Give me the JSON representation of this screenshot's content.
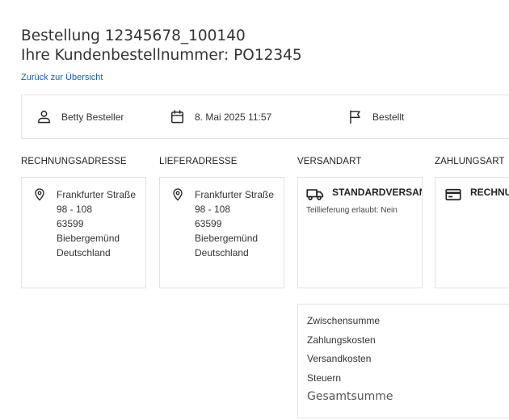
{
  "order": {
    "title": "Bestellung 12345678_100140",
    "customer_order_line": "Ihre Kundenbestellnummer: PO12345",
    "back_link": "Zurück zur Übersicht"
  },
  "summary": {
    "customer": "Betty Besteller",
    "date": "8. Mai 2025 11:57",
    "status": "Bestellt"
  },
  "sections": {
    "billing": {
      "heading": "RECHNUNGSADRESSE",
      "street": "Frankfurter Straße",
      "number": "98 - 108",
      "zip": "63599",
      "city": "Biebergemünd",
      "country": "Deutschland"
    },
    "shipping": {
      "heading": "LIEFERADRESSE",
      "street": "Frankfurter Straße",
      "number": "98 - 108",
      "zip": "63599",
      "city": "Biebergemünd",
      "country": "Deutschland"
    },
    "shipping_method": {
      "heading": "VERSANDART",
      "name": "STANDARDVERSAND",
      "note": "Teillieferung erlaubt: Nein"
    },
    "payment": {
      "heading": "ZAHLUNGSART",
      "name": "RECHNUNG"
    }
  },
  "totals": {
    "subtotal": "Zwischensumme",
    "payment_costs": "Zahlungskosten",
    "shipping_costs": "Versandkosten",
    "taxes": "Steuern",
    "grand_total": "Gesamtsumme"
  },
  "icons": {
    "customer": "user-icon",
    "date": "calendar-icon",
    "status": "flag-icon",
    "address": "map-pin-icon",
    "shipping": "truck-icon",
    "payment": "credit-card-icon"
  }
}
